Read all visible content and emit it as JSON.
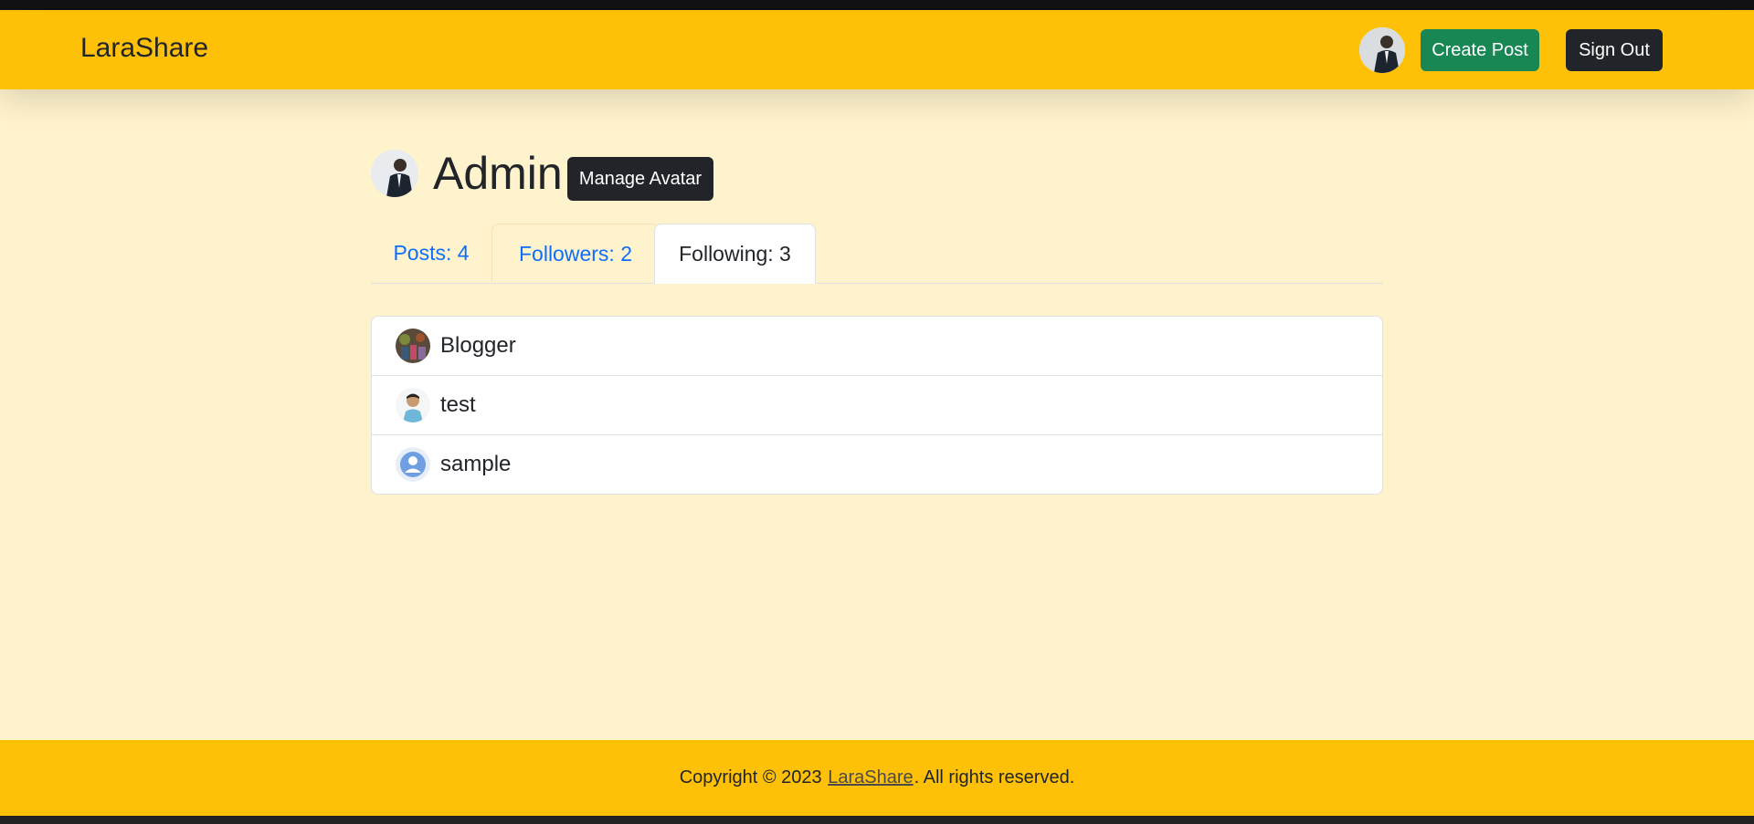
{
  "header": {
    "brand": "LaraShare",
    "create_post_label": "Create Post",
    "sign_out_label": "Sign Out"
  },
  "profile": {
    "username": "Admin",
    "manage_avatar_label": "Manage Avatar"
  },
  "tabs": [
    {
      "label": "Posts: 4",
      "active": false
    },
    {
      "label": "Followers: 2",
      "active": false
    },
    {
      "label": "Following: 3",
      "active": true
    }
  ],
  "following": [
    {
      "name": "Blogger",
      "avatar": "photo-avatar"
    },
    {
      "name": "test",
      "avatar": "person-avatar"
    },
    {
      "name": "sample",
      "avatar": "default-user-icon"
    }
  ],
  "footer": {
    "prefix": "Copyright © 2023",
    "link": "LaraShare",
    "suffix": ". All rights reserved."
  },
  "colors": {
    "navbar": "#ffc107",
    "page_bg": "#fff3cd",
    "create_button": "#198754",
    "dark_button": "#212529",
    "tab_link": "#0d6efd"
  }
}
